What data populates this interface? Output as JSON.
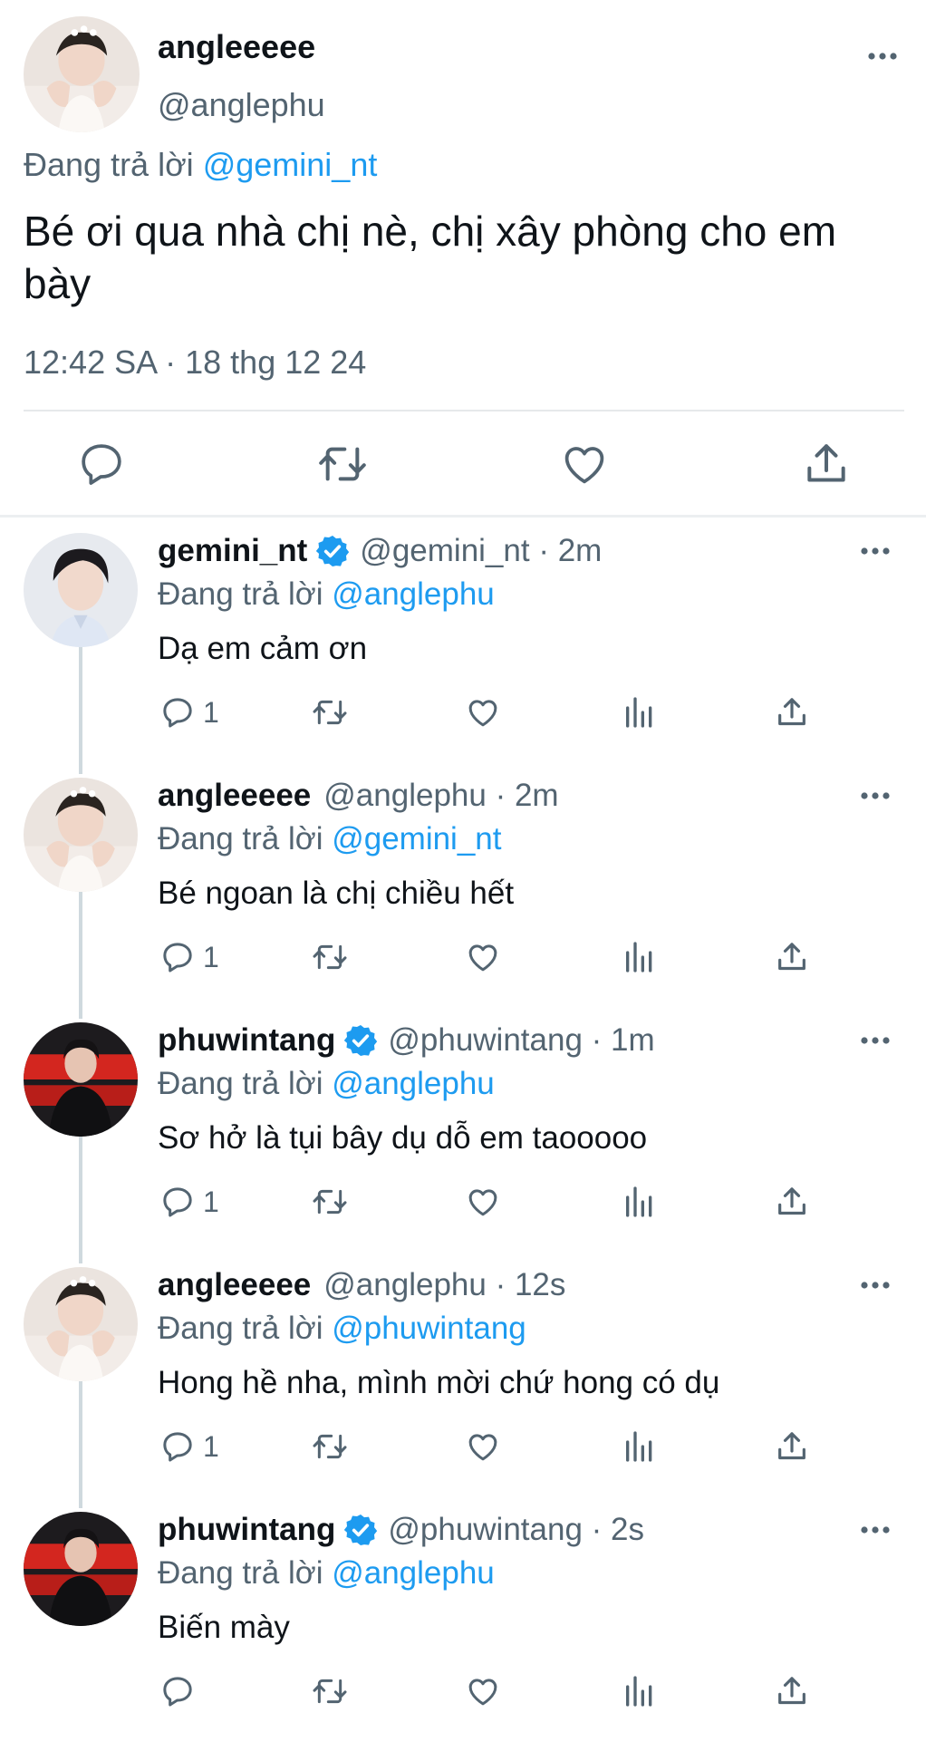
{
  "main_tweet": {
    "display_name": "angleeeee",
    "handle": "@anglephu",
    "replying_prefix": "Đang trả lời",
    "replying_to": "@gemini_nt",
    "text": "Bé ơi qua nhà chị nè, chị xây phòng cho em bày",
    "timestamp": "12:42 SA · 18 thg 12 24",
    "avatar_icon": "user-avatar-anglephu",
    "actions": [
      "reply-icon",
      "retweet-icon",
      "like-icon",
      "share-icon"
    ]
  },
  "replies": [
    {
      "display_name": "gemini_nt",
      "verified": true,
      "handle": "@gemini_nt",
      "time": "2m",
      "replying_prefix": "Đang trả lời",
      "replying_to": "@anglephu",
      "text": "Dạ em cảm ơn",
      "reply_count": "1"
    },
    {
      "display_name": "angleeeee",
      "verified": false,
      "handle": "@anglephu",
      "time": "2m",
      "replying_prefix": "Đang trả lời",
      "replying_to": "@gemini_nt",
      "text": "Bé ngoan là chị chiều hết",
      "reply_count": "1"
    },
    {
      "display_name": "phuwintang",
      "verified": true,
      "handle": "@phuwintang",
      "time": "1m",
      "replying_prefix": "Đang trả lời",
      "replying_to": "@anglephu",
      "text": "Sơ hở là tụi bây dụ dỗ em taooooo",
      "reply_count": "1"
    },
    {
      "display_name": "angleeeee",
      "verified": false,
      "handle": "@anglephu",
      "time": "12s",
      "replying_prefix": "Đang trả lời",
      "replying_to": "@phuwintang",
      "text": "Hong hề nha, mình mời chứ hong có dụ",
      "reply_count": "1"
    },
    {
      "display_name": "phuwintang",
      "verified": true,
      "handle": "@phuwintang",
      "time": "2s",
      "replying_prefix": "Đang trả lời",
      "replying_to": "@anglephu",
      "text": "Biến mày",
      "reply_count": ""
    }
  ],
  "colors": {
    "link_blue": "#1d9bf0",
    "secondary_gray": "#536471",
    "text_dark": "#0f1419",
    "divider": "#e6e9eb",
    "thread_line": "#cfd9de"
  }
}
